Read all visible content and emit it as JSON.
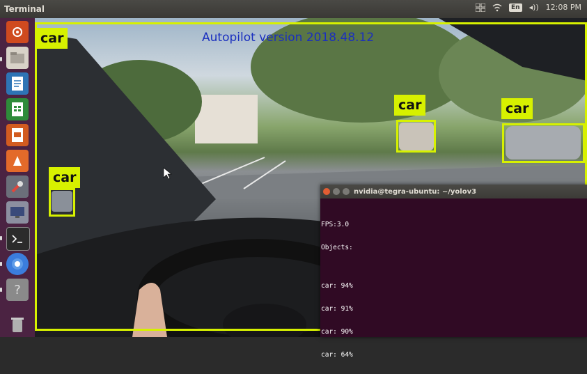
{
  "topbar": {
    "title": "Terminal",
    "keyboard": "En",
    "volume": "◂))",
    "time": "12:08 PM"
  },
  "launcher": {
    "items": [
      {
        "icon": "ubuntu-dash-icon",
        "color": "#cf4a1f"
      },
      {
        "icon": "files-icon",
        "color": "#d8d2c8"
      },
      {
        "icon": "writer-icon",
        "color": "#2e74b5"
      },
      {
        "icon": "calc-icon",
        "color": "#2e8b3a"
      },
      {
        "icon": "impress-icon",
        "color": "#d25b20"
      },
      {
        "icon": "software-center-icon",
        "color": "#e36a2a"
      },
      {
        "icon": "system-settings-icon",
        "color": "#6b6f7a"
      },
      {
        "icon": "monitor-icon",
        "color": "#8c8fa0"
      },
      {
        "icon": "terminal-icon",
        "color": "#2b2b2b"
      },
      {
        "icon": "chromium-icon",
        "color": "#3b7ddd"
      },
      {
        "icon": "unknown-app-icon",
        "color": "#8a8a8a"
      },
      {
        "icon": "trash-icon",
        "color": "#b0b0b0"
      }
    ]
  },
  "video": {
    "autopilot_text": "Autopilot version 2018.48.12",
    "detections": [
      {
        "label": "car"
      },
      {
        "label": "car"
      },
      {
        "label": "car"
      },
      {
        "label": "car"
      }
    ]
  },
  "terminal": {
    "title": "nvidia@tegra-ubuntu: ~/yolov3",
    "lines": [
      "FPS:3.0",
      "Objects:",
      "",
      "car: 94%",
      "car: 91%",
      "car: 90%",
      "car: 64%"
    ]
  }
}
